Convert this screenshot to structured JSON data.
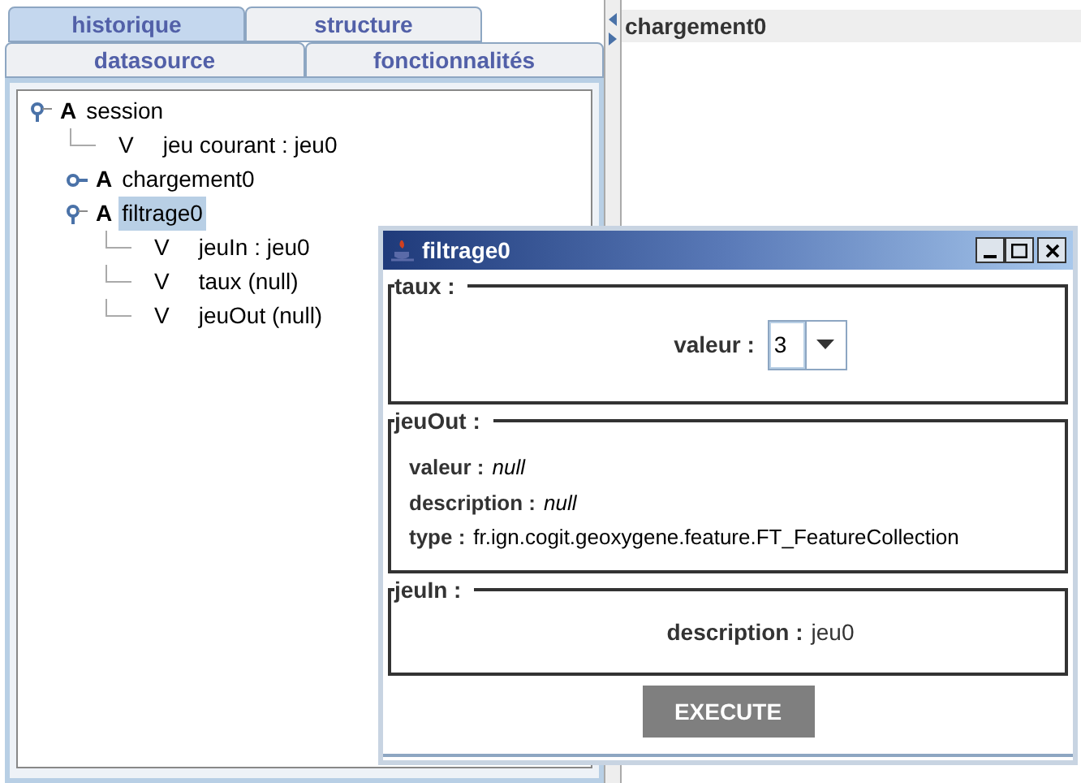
{
  "tabs_row_1": [
    {
      "label": "historique",
      "selected": true
    },
    {
      "label": "structure",
      "selected": false
    }
  ],
  "tabs_row_2": [
    {
      "label": "datasource",
      "selected": false
    },
    {
      "label": "fonctionnalités",
      "selected": false
    }
  ],
  "tree": [
    {
      "badge": "A",
      "label": "session",
      "expanded": true,
      "selected": false,
      "children": [
        {
          "badge": "V",
          "label": "jeu courant : jeu0"
        },
        {
          "badge": "A",
          "label": "chargement0",
          "expanded": false,
          "selected": false
        },
        {
          "badge": "A",
          "label": "filtrage0",
          "expanded": true,
          "selected": true,
          "children": [
            {
              "badge": "V",
              "label": "jeuIn : jeu0"
            },
            {
              "badge": "V",
              "label": "taux (null)"
            },
            {
              "badge": "V",
              "label": "jeuOut (null)"
            }
          ]
        }
      ]
    }
  ],
  "right_panel": {
    "title": "chargement0"
  },
  "dialog": {
    "title": "filtrage0",
    "taux": {
      "legend": "taux :",
      "label": "valeur :",
      "value": "3"
    },
    "jeuOut": {
      "legend": "jeuOut :",
      "rows": [
        {
          "label": "valeur :",
          "value": "null",
          "italic": true
        },
        {
          "label": "description :",
          "value": "null",
          "italic": true
        },
        {
          "label": "type :",
          "value": "fr.ign.cogit.geoxygene.feature.FT_FeatureCollection",
          "italic": false
        }
      ]
    },
    "jeuIn": {
      "legend": "jeuIn :",
      "label": "description :",
      "value": "jeu0"
    },
    "button": "EXECUTE"
  }
}
